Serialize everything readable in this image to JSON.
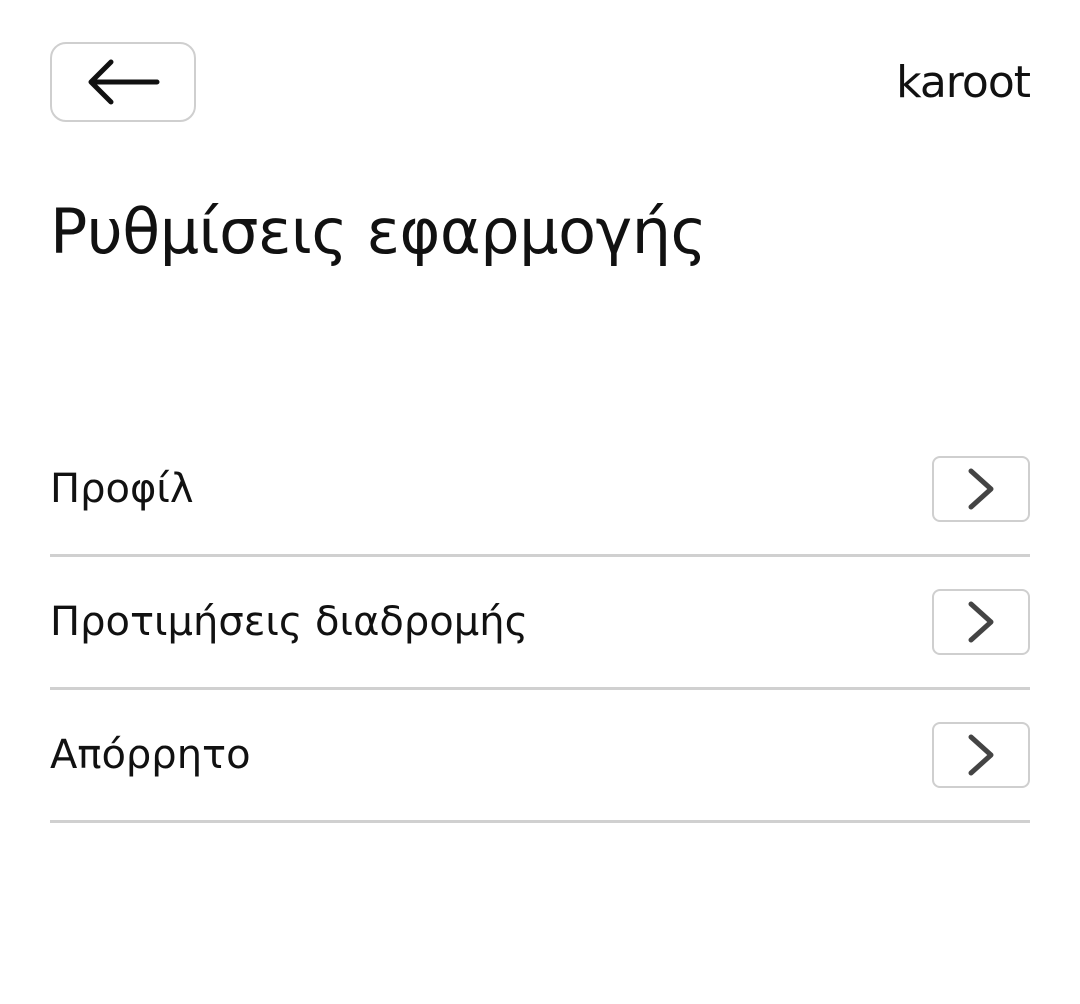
{
  "header": {
    "back_icon": "arrow-left-icon",
    "logo_text": "karoot"
  },
  "page": {
    "title": "Ρυθμίσεις εφαρμογής"
  },
  "settings": {
    "items": [
      {
        "label": "Προφίλ",
        "icon": "chevron-right-icon"
      },
      {
        "label": "Προτιμήσεις διαδρομής",
        "icon": "chevron-right-icon"
      },
      {
        "label": "Απόρρητο",
        "icon": "chevron-right-icon"
      }
    ]
  },
  "colors": {
    "text": "#111111",
    "border": "#cfcfcf",
    "divider": "#d0d0d0",
    "background": "#ffffff"
  }
}
